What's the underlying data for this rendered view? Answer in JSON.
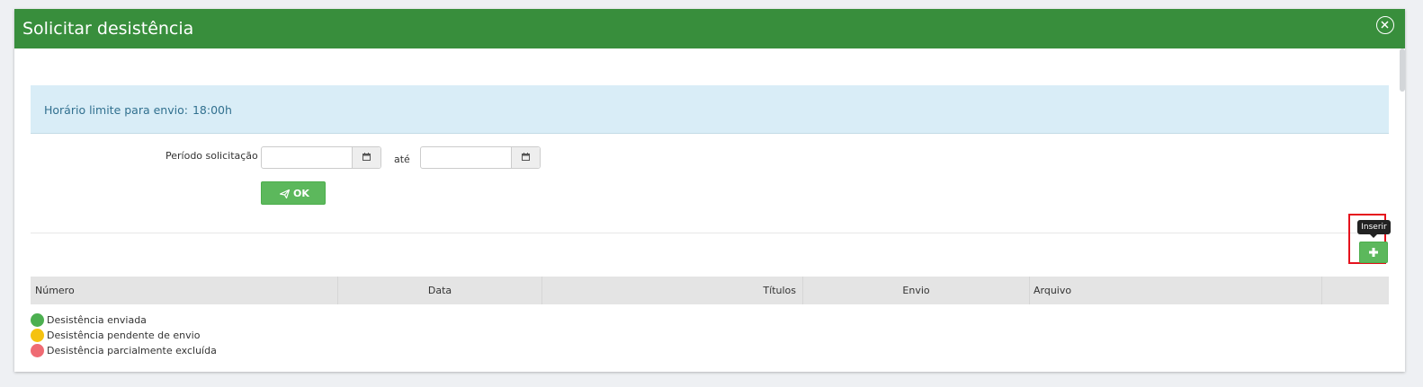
{
  "modal": {
    "title": "Solicitar desistência",
    "close_icon": "close-circle-icon"
  },
  "alert": {
    "label": "Horário limite para envio:",
    "value": "18:00h"
  },
  "filter": {
    "period_label": "Período solicitação",
    "start_value": "",
    "separator": "até",
    "end_value": "",
    "calendar_icon": "calendar-icon",
    "ok_label": "OK",
    "ok_icon": "paper-plane-icon"
  },
  "toolbar": {
    "insert_tooltip": "Inserir",
    "insert_icon": "plus-icon"
  },
  "table": {
    "columns": [
      "Número",
      "Data",
      "Títulos",
      "Envio",
      "Arquivo",
      ""
    ]
  },
  "legend": [
    {
      "label": "Desistência enviada",
      "color": "#4caf50"
    },
    {
      "label": "Desistência pendente de envio",
      "color": "#f5c211"
    },
    {
      "label": "Desistência parcialmente excluída",
      "color": "#ef6b73"
    }
  ],
  "colors": {
    "header": "#388e3c",
    "alert_bg": "#d9edf7",
    "alert_text": "#31708f",
    "button": "#5cb85c",
    "highlight": "#e5121d"
  }
}
